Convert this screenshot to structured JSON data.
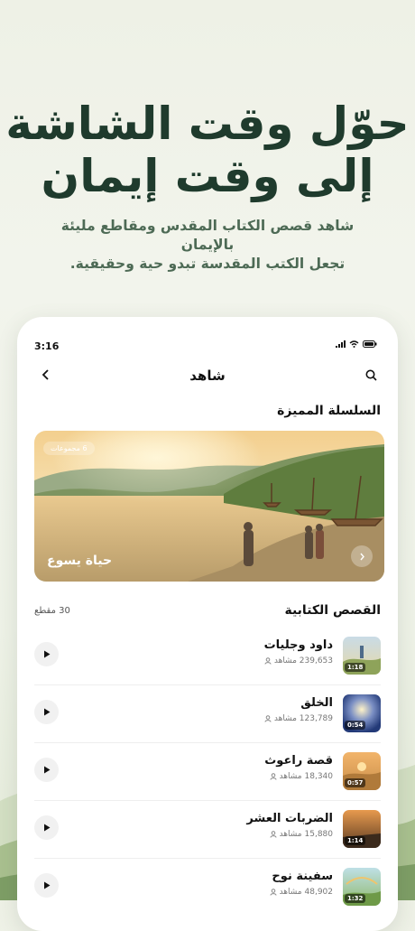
{
  "hero": {
    "title_line1": "حوّل وقت الشاشة",
    "title_line2": "إلى وقت إيمان",
    "subtitle_line1": "شاهد قصص الكتاب المقدس ومقاطع مليئة بالإيمان",
    "subtitle_line2": "تجعل الكتب المقدسة تبدو حية وحقيقية."
  },
  "status_bar": {
    "time": "3:16"
  },
  "nav": {
    "title": "شاهد",
    "back_icon": "chevron-left-icon",
    "search_icon": "search-icon"
  },
  "featured": {
    "section_title": "السلسلة المميزة",
    "badge": "6 مجموعات",
    "title": "حياة يسوع"
  },
  "stories": {
    "section_title": "القصص الكتابية",
    "count": "30 مقطع",
    "items": [
      {
        "title": "داود وجليات",
        "views": "239,653 مشاهد",
        "duration": "1:18"
      },
      {
        "title": "الخلق",
        "views": "123,789 مشاهد",
        "duration": "0:54"
      },
      {
        "title": "قصة راعوث",
        "views": "18,340 مشاهد",
        "duration": "0:57"
      },
      {
        "title": "الضربات العشر",
        "views": "15,880 مشاهد",
        "duration": "1:14"
      },
      {
        "title": "سفينة نوح",
        "views": "48,902 مشاهد",
        "duration": "1:32"
      }
    ]
  },
  "colors": {
    "accent": "#1f3b2d",
    "subtitle": "#4d6a55",
    "background": "#eef1e6"
  }
}
